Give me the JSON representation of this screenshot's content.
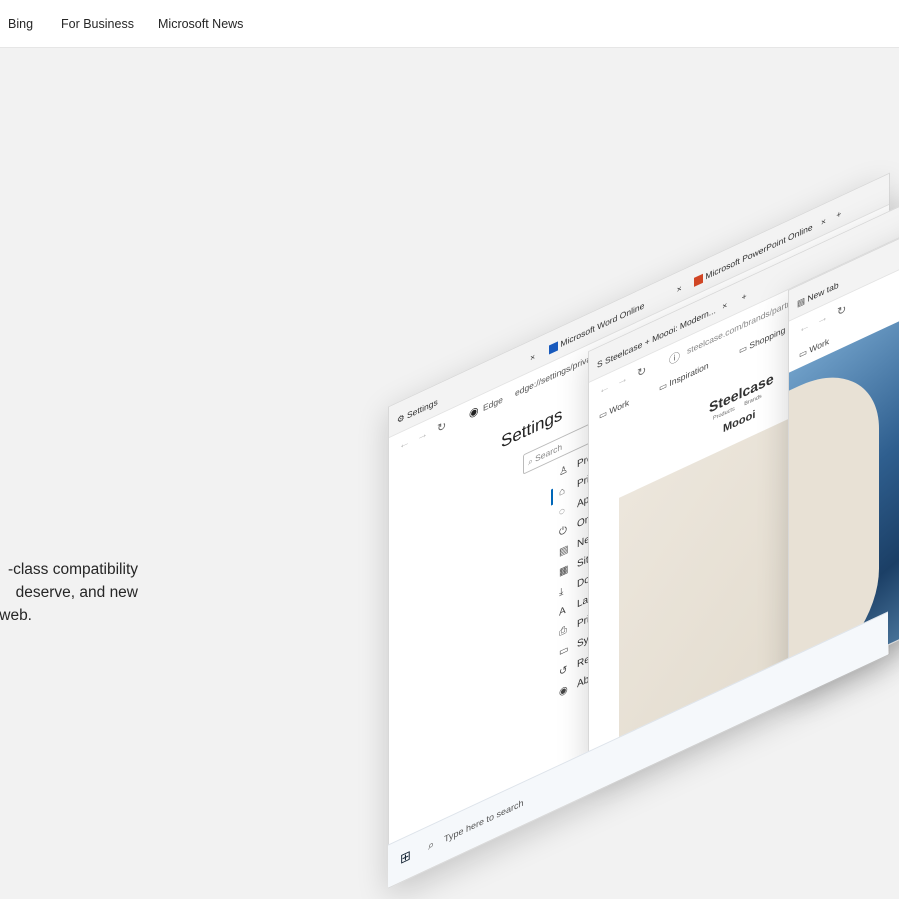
{
  "topnav": {
    "items": [
      "Bing",
      "For Business",
      "Microsoft News"
    ]
  },
  "hero": {
    "lines": [
      "-class compatibility",
      " deserve, and new",
      "web."
    ]
  },
  "settings_window": {
    "tabs": [
      {
        "label": "Settings",
        "close": "×"
      },
      {
        "label": "Microsoft Word Online",
        "close": "×"
      },
      {
        "label": "Microsoft PowerPoint Online",
        "close": "×"
      }
    ],
    "new_tab": "+",
    "address_prefix": "Edge",
    "address": "edge://settings/privacy",
    "title": "Settings",
    "search_placeholder": "Search",
    "menu": [
      {
        "label": "Profiles",
        "icon": "person-icon"
      },
      {
        "label": "Privacy and services",
        "icon": "lock-icon"
      },
      {
        "label": "Appearance",
        "icon": "palette-icon"
      },
      {
        "label": "On startup",
        "icon": "power-icon"
      },
      {
        "label": "New tab page",
        "icon": "newtab-icon"
      },
      {
        "label": "Site permissions",
        "icon": "permissions-icon"
      },
      {
        "label": "Downloads",
        "icon": "download-icon"
      },
      {
        "label": "Languages",
        "icon": "languages-icon"
      },
      {
        "label": "Printers",
        "icon": "printer-icon"
      },
      {
        "label": "System",
        "icon": "system-icon"
      },
      {
        "label": "Reset settings",
        "icon": "reset-icon"
      },
      {
        "label": "About Microsoft Edge",
        "icon": "edge-icon"
      }
    ],
    "selected_index": 1
  },
  "steelcase_window": {
    "tab": "Steelcase + Moooi: Modern...",
    "close": "×",
    "new_tab": "+",
    "address": "steelcase.com/brands/partners/moooi",
    "favorites": [
      "Work",
      "Inspiration",
      "Shopping"
    ],
    "brand": "Steelcase",
    "brand_sub": [
      "Products",
      "Brands"
    ],
    "partner": "Moooi"
  },
  "newtab_window": {
    "tab": "New tab",
    "favorites": [
      "Work"
    ]
  },
  "taskbar": {
    "search_placeholder": "Type here to search"
  },
  "colors": {
    "accent": "#0067b8",
    "background": "#f2f2f2"
  }
}
